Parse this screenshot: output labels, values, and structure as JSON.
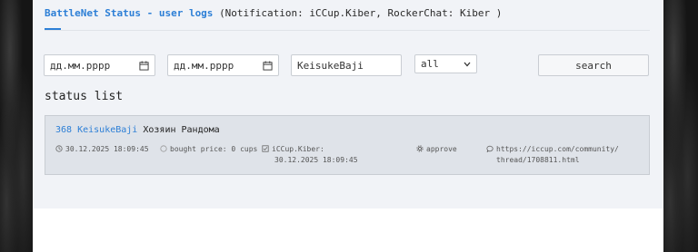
{
  "header": {
    "tab_label": "BattleNet Status - user logs",
    "notification_text": "(Notification: iCCup.Kiber, RockerChat: Kiber )"
  },
  "filters": {
    "date_from": "дд.мм.рррр",
    "date_to": "дд.мм.рррр",
    "user_value": "KeisukeBaji",
    "status_selected": "all",
    "search_label": "search"
  },
  "section_title": "status list",
  "logs": [
    {
      "id": "368",
      "user": "KeisukeBaji",
      "status_text": "Хозяин Рандома",
      "time": "30.12.2025 18:09:45",
      "price": "bought price: 0 cups",
      "approver_line1": "iCCup.Kiber:",
      "approver_line2": "30.12.2025 18:09:45",
      "action": "approve",
      "link_line1": "https://iccup.com/community/",
      "link_line2": "thread/1708811.html"
    }
  ],
  "colors": {
    "accent": "#2d7fd6",
    "panel": "#f1f3f7",
    "card": "#dfe3e9"
  }
}
